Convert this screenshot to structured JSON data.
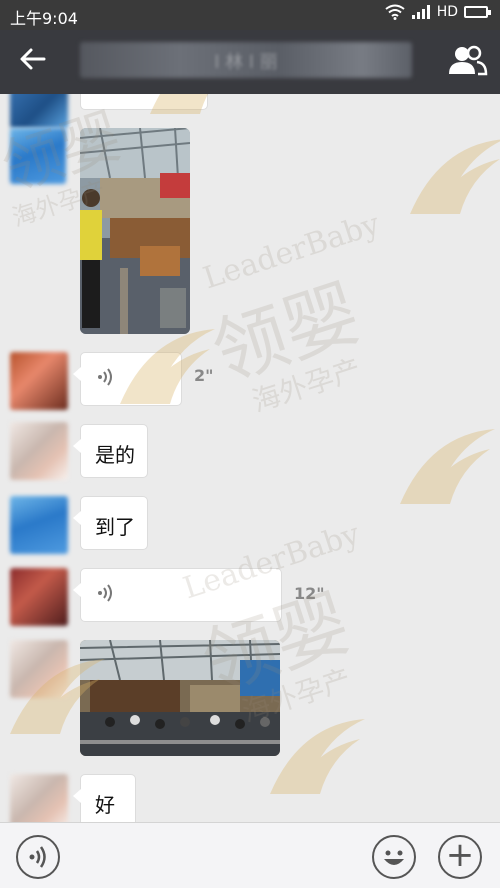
{
  "status_bar": {
    "time": "上午9:04",
    "network": "HD"
  },
  "header": {
    "title": "l 林 l 丽",
    "back_icon": "arrow-left-icon",
    "group_icon": "group-people-icon"
  },
  "messages": [
    {
      "type": "image",
      "desc": "partial image"
    },
    {
      "type": "image",
      "desc": "market photo"
    },
    {
      "type": "voice",
      "duration": "2\""
    },
    {
      "type": "text",
      "text": "是的"
    },
    {
      "type": "text",
      "text": "到了"
    },
    {
      "type": "voice",
      "duration": "12\""
    },
    {
      "type": "image",
      "desc": "terminal hall photo"
    },
    {
      "type": "text",
      "text": "好"
    }
  ],
  "watermark": {
    "brand": "LeaderBaby",
    "cn_name": "领婴",
    "tagline": "海外孕产"
  },
  "input_bar": {
    "voice_icon": "voice-input-icon",
    "emoji_icon": "emoji-icon",
    "plus_icon": "plus-icon",
    "plus_label": "+"
  },
  "colors": {
    "nav": "#393a3f",
    "background": "#ebebeb",
    "bubble": "#ffffff",
    "watermark": "#c9a86a"
  }
}
